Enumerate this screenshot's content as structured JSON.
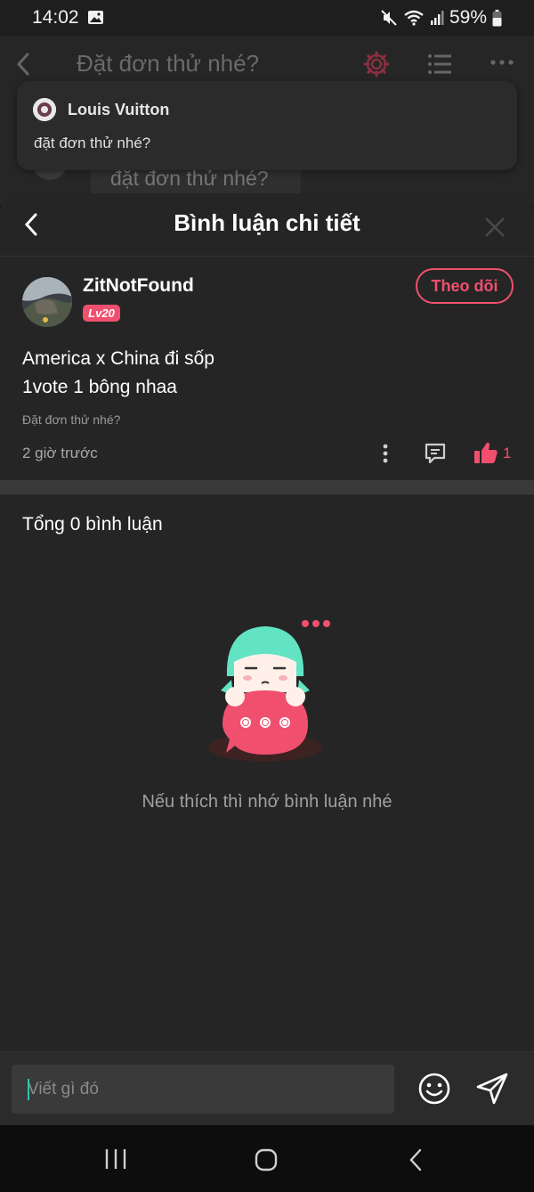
{
  "status_bar": {
    "time": "14:02",
    "battery": "59%"
  },
  "background_page": {
    "title": "Đặt đơn thử nhé?",
    "subtitle": "đặt đơn thử nhé?"
  },
  "notification": {
    "sender": "Louis Vuitton",
    "message": "đặt đơn thử nhé?"
  },
  "sheet": {
    "title": "Bình luận chi tiết",
    "post": {
      "username": "ZitNotFound",
      "level": "Lv20",
      "follow_label": "Theo dõi",
      "content_line1": "America x China đi sốp",
      "content_line2": "1vote 1 bông nhaa",
      "reference": "Đặt đơn thử nhé?",
      "time": "2 giờ trước",
      "likes": "1"
    },
    "total_comments": "Tổng 0 bình luận",
    "empty_message": "Nếu thích thì nhớ bình luận nhé"
  },
  "input": {
    "placeholder": "Viết gì đó"
  },
  "colors": {
    "accent": "#f0506e",
    "teal": "#2bc4b0",
    "background": "#252525"
  }
}
